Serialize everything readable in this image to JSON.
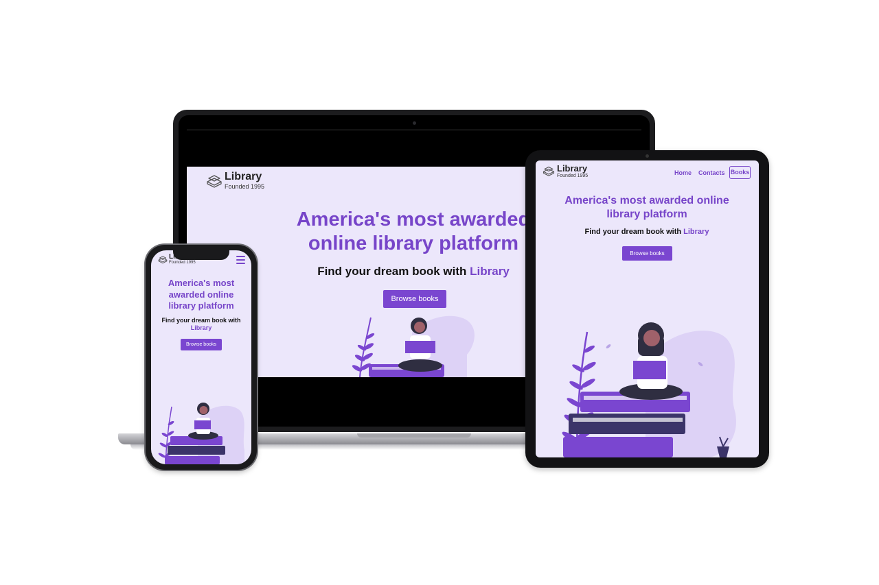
{
  "site": {
    "brand_name": "Library",
    "brand_tagline": "Founded 1995",
    "hero_title": "America's most awarded online library platform",
    "hero_title_line1": "America's most awarded",
    "hero_title_line2": "online library platform",
    "hero_sub_prefix": "Find your dream book with ",
    "hero_sub_accent": "Library",
    "cta_label": "Browse books",
    "nav": [
      "Home",
      "Contacts",
      "Books"
    ],
    "colors": {
      "accent": "#7745c9",
      "background": "#ece7fb",
      "dark_book": "#3b3469"
    }
  },
  "tablet": {
    "title_line1": "America's most awarded online",
    "title_line2": "library platform"
  },
  "phone": {
    "title_line1": "America's most",
    "title_line2": "awarded online",
    "title_line3": "library platform",
    "sub_line1": "Find your dream book with",
    "menu_icon": "hamburger-menu-icon"
  }
}
